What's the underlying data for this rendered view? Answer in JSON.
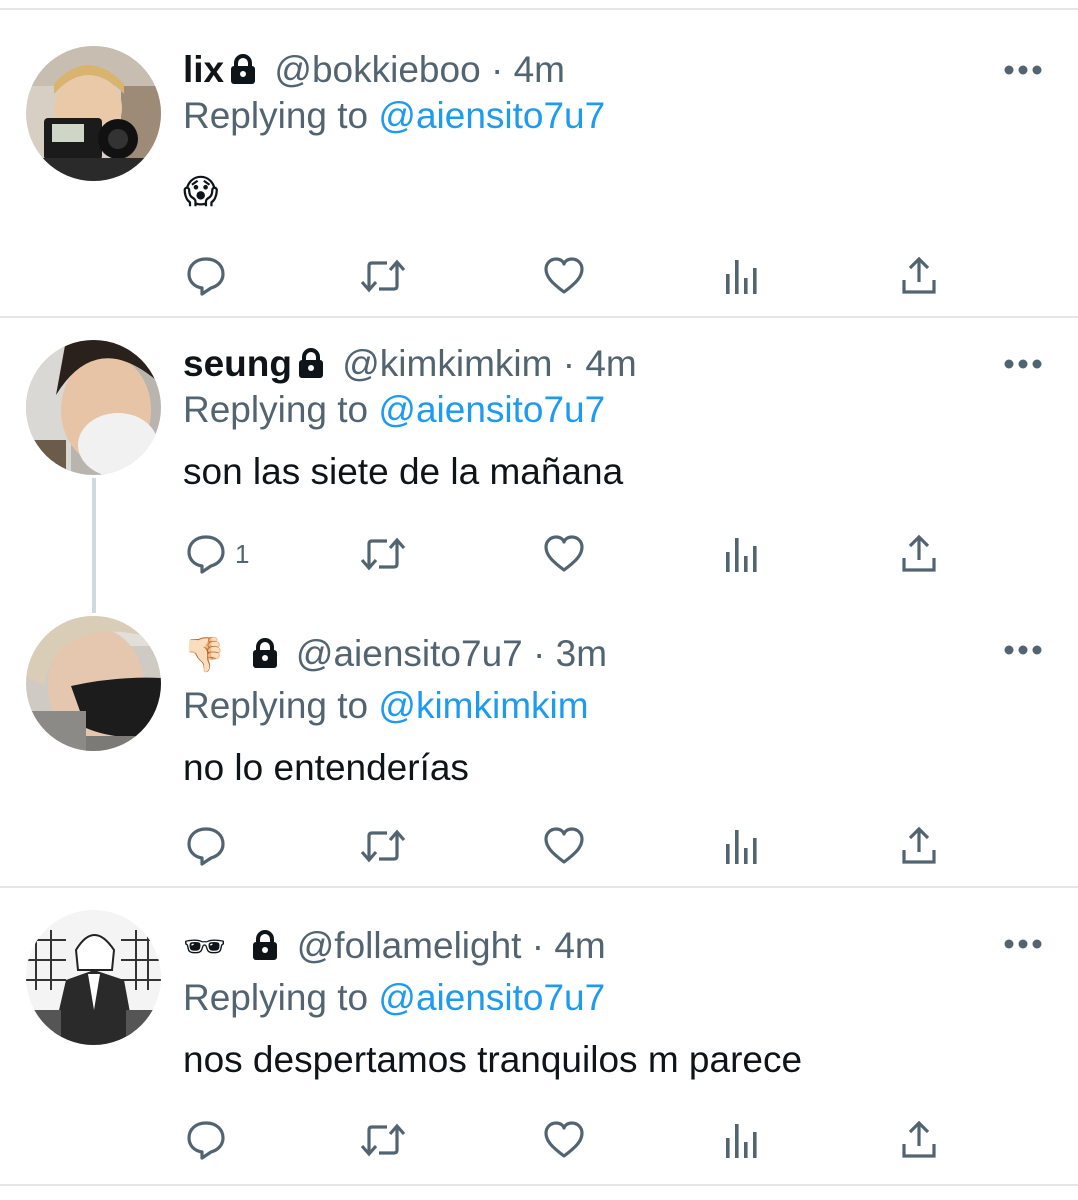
{
  "tweets": [
    {
      "display_name": "lix",
      "handle": "@bokkieboo",
      "time": "4m",
      "replying_label": "Replying to",
      "replying_to": "@aiensito7u7",
      "text": "😱",
      "reply_count": "",
      "avatar": "photo-person-camera"
    },
    {
      "display_name": "seung",
      "handle": "@kimkimkim",
      "time": "4m",
      "replying_label": "Replying to",
      "replying_to": "@aiensito7u7",
      "text": "son las siete de la mañana",
      "reply_count": "1",
      "avatar": "photo-person-mask"
    },
    {
      "display_name": "👎🏻",
      "handle": "@aiensito7u7",
      "time": "3m",
      "replying_label": "Replying to",
      "replying_to": "@kimkimkim",
      "text": "no lo entenderías",
      "reply_count": "",
      "avatar": "photo-person-black-mask"
    },
    {
      "display_name": "🕶",
      "handle": "@follamelight",
      "time": "4m",
      "replying_label": "Replying to",
      "replying_to": "@aiensito7u7",
      "text": "nos despertamos tranquilos m parece",
      "reply_count": "",
      "avatar": "manga-character-drawing"
    }
  ],
  "separator": "·",
  "icons": [
    "lock-icon",
    "more-icon",
    "reply-icon",
    "retweet-icon",
    "like-icon",
    "views-icon",
    "share-icon"
  ],
  "colors": {
    "link": "#1d9bf0",
    "muted": "#536471",
    "text": "#0f1419",
    "divider": "#e6e6e6"
  }
}
